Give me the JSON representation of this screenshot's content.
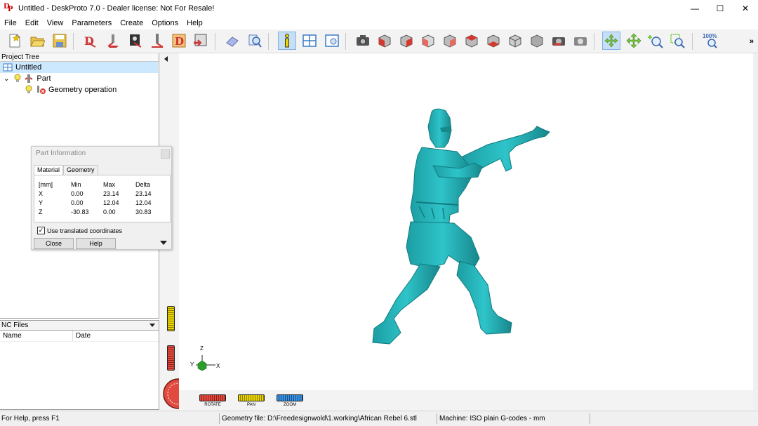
{
  "window": {
    "title": "Untitled - DeskProto 7.0 - Dealer license: Not For Resale!",
    "minimize_glyph": "—",
    "maximize_glyph": "☐",
    "close_glyph": "✕"
  },
  "menu": [
    "File",
    "Edit",
    "View",
    "Parameters",
    "Create",
    "Options",
    "Help"
  ],
  "toolbar": {
    "zoom_label": "100%",
    "overflow_glyph": "»",
    "icons": [
      "new-icon",
      "open-icon",
      "save-icon",
      "part-wizard-icon",
      "operation-wizard-icon",
      "image-wizard-icon",
      "toolpath-icon",
      "d-icon",
      "export-icon",
      "erase-icon",
      "preview-icon",
      "info-icon",
      "window-layout-icon",
      "view-icon",
      "camera-icon",
      "view-front-icon",
      "view-back-icon",
      "view-left-icon",
      "view-right-icon",
      "view-top-icon",
      "view-bottom-icon",
      "view-iso-icon",
      "view-parallel-icon",
      "render-icon",
      "render-alt-icon",
      "rotate-icon",
      "pan-icon",
      "zoom-in-icon",
      "zoom-window-icon",
      "zoom-fit-icon"
    ]
  },
  "project_tree": {
    "header": "Project Tree",
    "root": "Untitled",
    "part": "Part",
    "operation": "Geometry operation"
  },
  "nc_files": {
    "header": "NC Files",
    "col_name": "Name",
    "col_date": "Date"
  },
  "dialog": {
    "title": "Part Information",
    "tabs": [
      "Material",
      "Geometry"
    ],
    "table": {
      "header": [
        "[mm]",
        "Min",
        "Max",
        "Delta"
      ],
      "rows": [
        [
          "X",
          "0.00",
          "23.14",
          "23.14"
        ],
        [
          "Y",
          "0.00",
          "12.04",
          "12.04"
        ],
        [
          "Z",
          "-30.83",
          "0.00",
          "30.83"
        ]
      ]
    },
    "checkbox_label": "Use translated coordinates",
    "checkbox_checked": true,
    "close_label": "Close",
    "help_label": "Help"
  },
  "axes": {
    "x": "X",
    "y": "Y",
    "z": "Z"
  },
  "controls": {
    "rotate": "ROTATE",
    "pan": "PAN",
    "zoom": "ZOOM"
  },
  "status": {
    "help": "For Help, press F1",
    "geometry": "Geometry file: D:\\Freedesignwold\\1.working\\African Rebel 6.stl",
    "machine": "Machine: ISO plain G-codes - mm"
  },
  "colors": {
    "model": "#2bb8bd",
    "model_shadow": "#127d82",
    "selection": "#cce8ff",
    "accent_red": "#d33a2f",
    "accent_yellow": "#e8d400"
  }
}
